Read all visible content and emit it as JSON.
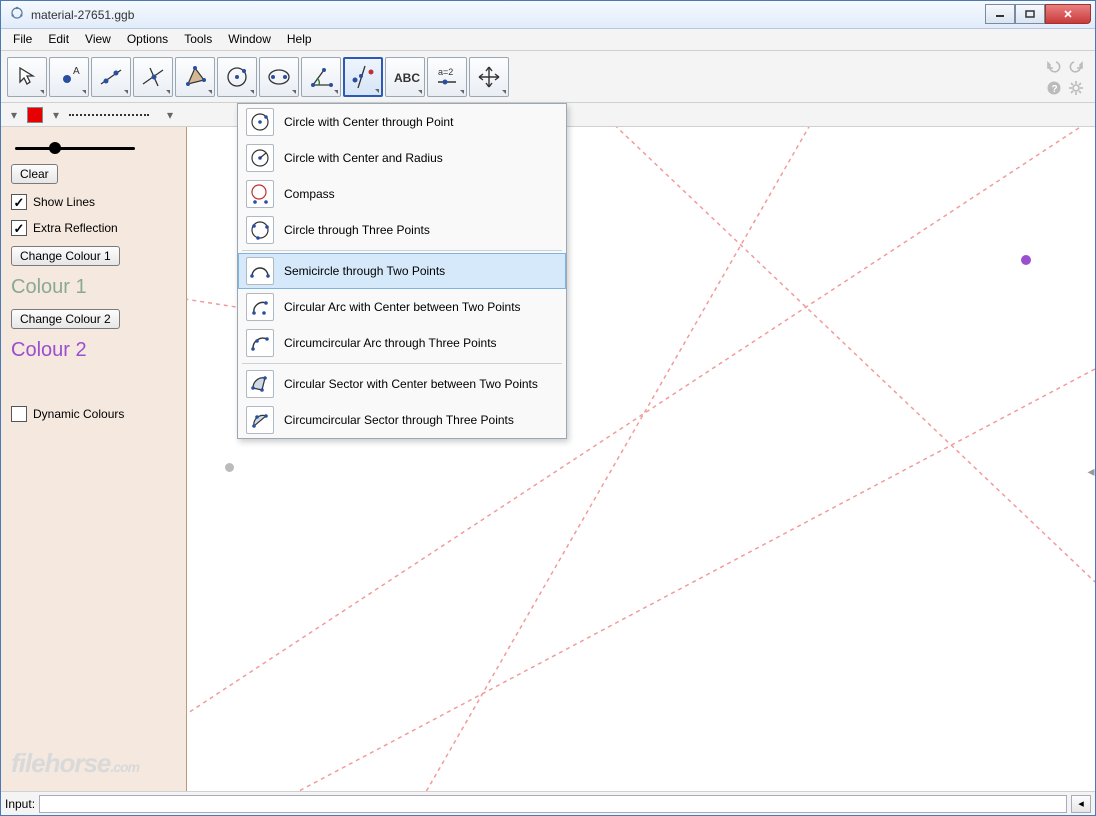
{
  "window": {
    "title": "material-27651.ggb"
  },
  "menubar": [
    "File",
    "Edit",
    "View",
    "Options",
    "Tools",
    "Window",
    "Help"
  ],
  "toolbar_tools": [
    "move",
    "point",
    "line",
    "perpendicular",
    "polygon",
    "circle",
    "ellipse",
    "angle",
    "reflect",
    "text",
    "slider",
    "move-graphics"
  ],
  "selected_tool_index": 8,
  "sidebar": {
    "clear": "Clear",
    "show_lines": "Show Lines",
    "extra_reflection": "Extra Reflection",
    "change_colour_1": "Change Colour 1",
    "colour1_label": "Colour 1",
    "change_colour_2": "Change Colour 2",
    "colour2_label": "Colour 2",
    "dynamic_colours": "Dynamic Colours"
  },
  "dropdown": {
    "items": [
      "Circle with Center through Point",
      "Circle with Center and Radius",
      "Compass",
      "Circle through Three Points",
      "Semicircle through Two Points",
      "Circular Arc with Center between Two Points",
      "Circumcircular Arc through Three Points",
      "Circular Sector with Center between Two Points",
      "Circumcircular Sector through Three Points"
    ],
    "hovered_index": 4
  },
  "inputbar": {
    "label": "Input:",
    "value": ""
  },
  "watermark": {
    "main": "filehorse",
    "suffix": ".com"
  }
}
